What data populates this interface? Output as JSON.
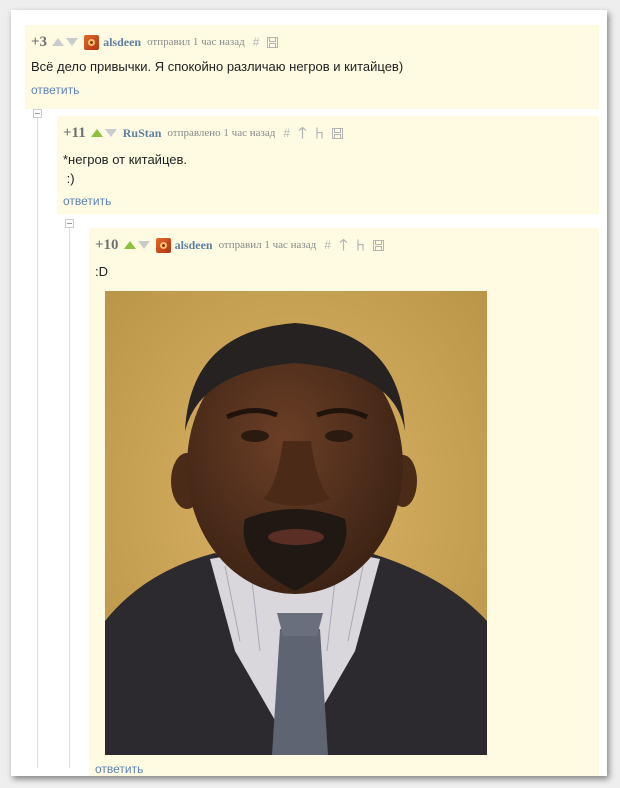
{
  "comments": [
    {
      "rating": "+3",
      "author": "alsdeen",
      "time": "отправил 1 час назад",
      "text_lines": [
        "Всё дело привычки. Я спокойно различаю негров и китайцев)"
      ],
      "reply": "ответить"
    },
    {
      "rating": "+11",
      "author": "RuStan",
      "time": "отправлено 1 час назад",
      "text_lines": [
        "*негров от китайцев.",
        " :)"
      ],
      "reply": "ответить"
    },
    {
      "rating": "+10",
      "author": "alsdeen",
      "time": "отправил 1 час назад",
      "text_lines": [
        ":D"
      ],
      "reply": "ответить"
    }
  ],
  "colors": {
    "comment_bg": "#fffbe3",
    "link": "#5c82b7",
    "author": "#5f7fa3",
    "upvote_active": "#8ec13d"
  }
}
